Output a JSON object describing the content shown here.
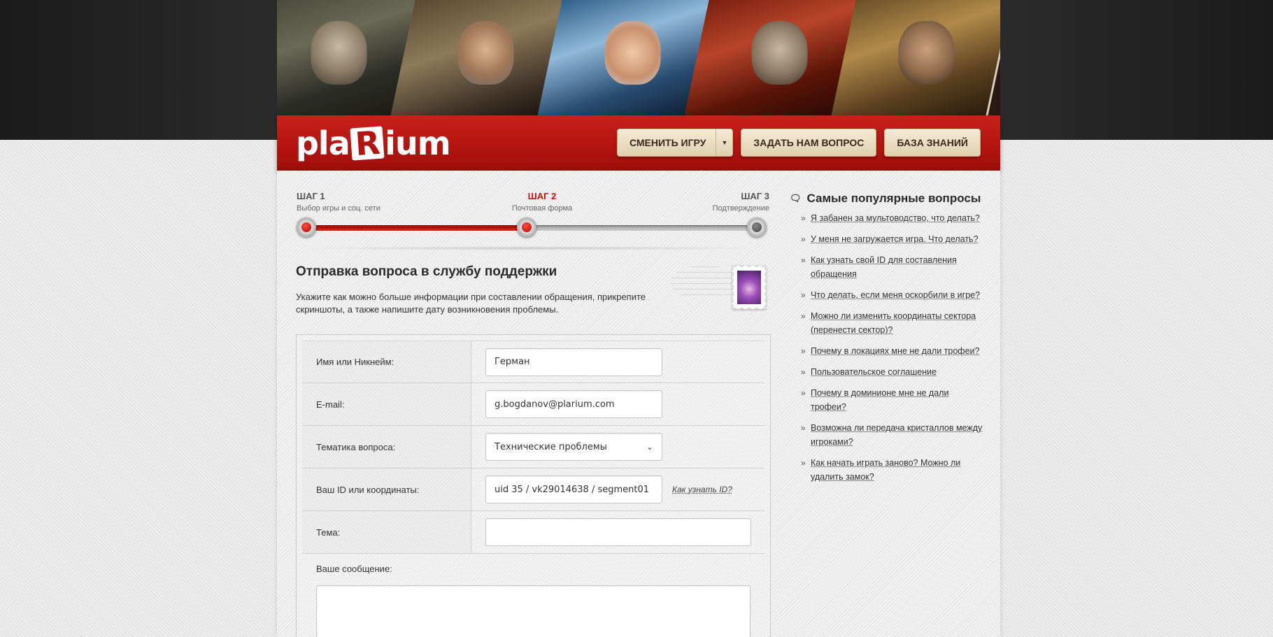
{
  "header": {
    "logo": {
      "pre": "pla",
      "boxed": "R",
      "post": "ium"
    },
    "nav": {
      "change_game": "СМЕНИТЬ ИГРУ",
      "ask_question": "ЗАДАТЬ НАМ ВОПРОС",
      "knowledge_base": "БАЗА ЗНАНИЙ"
    }
  },
  "steps": [
    {
      "num": "ШАГ 1",
      "desc": "Выбор игры и соц. сети",
      "state": "done"
    },
    {
      "num": "ШАГ 2",
      "desc": "Почтовая форма",
      "state": "active"
    },
    {
      "num": "ШАГ 3",
      "desc": "Подтверждение",
      "state": "pending"
    }
  ],
  "progress_fraction": 0.49,
  "form": {
    "title": "Отправка вопроса в службу поддержки",
    "intro": "Укажите как можно больше информации при составлении обращения, прикрепите скриншоты, а также напишите дату возникновения проблемы.",
    "fields": {
      "name": {
        "label": "Имя или Никнейм:",
        "value": "Герман"
      },
      "email": {
        "label": "E-mail:",
        "value": "g.bogdanov@plarium.com"
      },
      "topic": {
        "label": "Тематика вопроса:",
        "value": "Технические проблемы"
      },
      "id": {
        "label": "Ваш ID или координаты:",
        "value": "uid 35 / vk29014638 / segment01",
        "help_link": "Как узнать ID?"
      },
      "subject": {
        "label": "Тема:",
        "value": ""
      },
      "message": {
        "label": "Ваше сообщение:",
        "value": ""
      }
    }
  },
  "sidebar": {
    "title": "Самые популярные вопросы",
    "items": [
      "Я забанен за мультоводство, что делать?",
      "У меня не загружается игра. Что делать?",
      "Как узнать свой ID для составления обращения",
      "Что делать, если меня оскорбили в игре?",
      "Можно ли изменить координаты сектора (перенести сектор)?",
      "Почему в локациях мне не дали трофеи?",
      "Пользовательское соглашение",
      "Почему в доминионе мне не дали трофеи?",
      "Возможна ли передача кристаллов между игроками?",
      "Как начать играть заново? Можно ли удалить замок?"
    ]
  },
  "colors": {
    "brand_red": "#b3140f",
    "active_step": "#c0140e",
    "nav_button": "#e8dcc0"
  }
}
